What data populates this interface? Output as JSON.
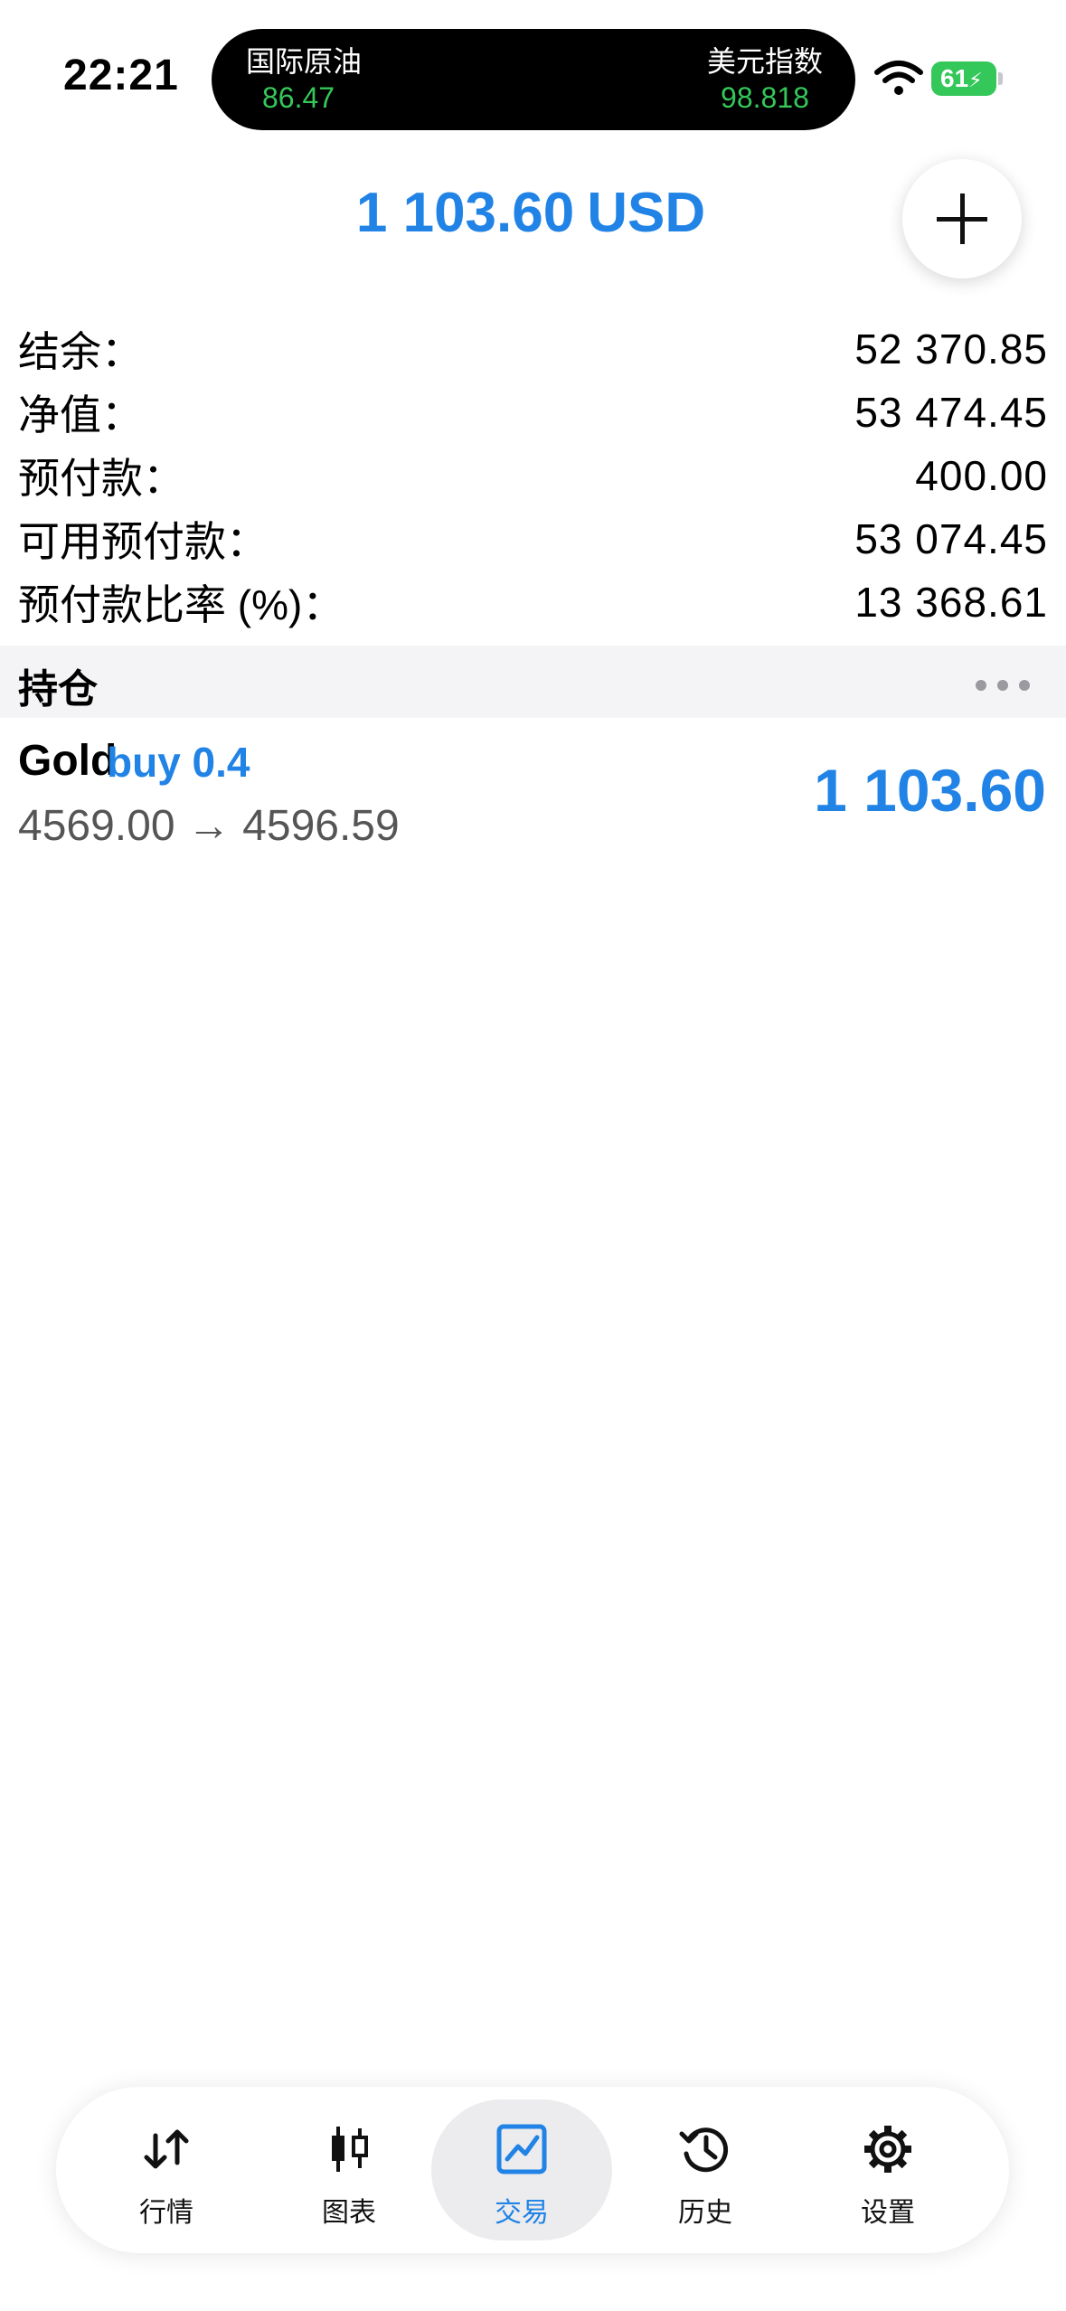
{
  "status_bar": {
    "time": "22:21",
    "battery": "61",
    "tickers": [
      {
        "name": "国际原油",
        "value": "86.47"
      },
      {
        "name": "美元指数",
        "value": "98.818"
      }
    ],
    "icons": [
      "wifi-icon",
      "battery-icon",
      "charging-bolt-icon"
    ]
  },
  "header": {
    "total_profit": "1 103.60",
    "currency": "USD",
    "add_icon": "plus-icon"
  },
  "account": [
    {
      "label": "结余：",
      "value": "52 370.85"
    },
    {
      "label": "净值：",
      "value": "53 474.45"
    },
    {
      "label": "预付款：",
      "value": "400.00"
    },
    {
      "label": "可用预付款：",
      "value": "53 074.45"
    },
    {
      "label": "预付款比率 (%)：",
      "value": "13 368.61"
    }
  ],
  "positions": {
    "title": "持仓",
    "more_icon": "more-dots-icon",
    "items": [
      {
        "symbol": "Gold",
        "side": "buy 0.4",
        "prices": "4569.00 → 4596.59",
        "profit": "1 103.60"
      }
    ]
  },
  "tabbar": {
    "active_index": 2,
    "tabs": [
      {
        "label": "行情",
        "icon": "quotes-arrows-icon"
      },
      {
        "label": "图表",
        "icon": "candlestick-chart-icon"
      },
      {
        "label": "交易",
        "icon": "trade-line-chart-icon"
      },
      {
        "label": "历史",
        "icon": "history-clock-icon"
      },
      {
        "label": "设置",
        "icon": "gear-icon"
      }
    ]
  },
  "colors": {
    "accent": "#2083e5",
    "ticker_green": "#34c759",
    "battery_green": "#34c759",
    "section_bg": "#f4f4f6"
  }
}
